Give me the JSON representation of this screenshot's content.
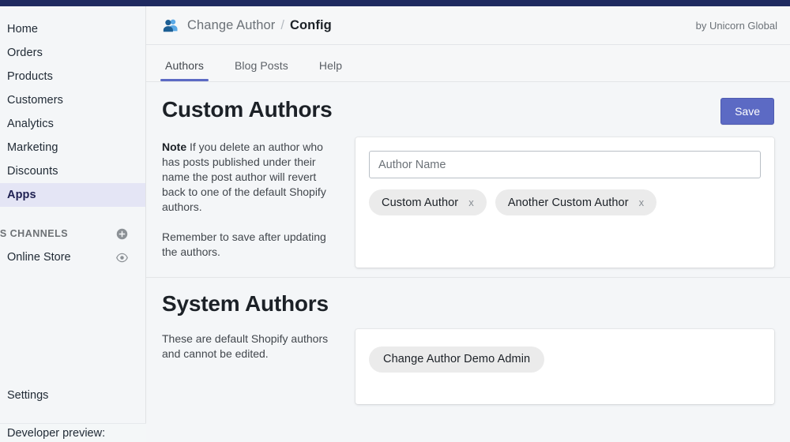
{
  "topbar": {
    "color": "#1f2a60"
  },
  "sidebar": {
    "items": [
      {
        "label": "Home",
        "active": false
      },
      {
        "label": "Orders",
        "active": false
      },
      {
        "label": "Products",
        "active": false
      },
      {
        "label": "Customers",
        "active": false
      },
      {
        "label": "Analytics",
        "active": false
      },
      {
        "label": "Marketing",
        "active": false
      },
      {
        "label": "Discounts",
        "active": false
      },
      {
        "label": "Apps",
        "active": true
      }
    ],
    "section_label": "ES CHANNELS",
    "section_add_icon": "plus-circle-icon",
    "channels": [
      {
        "label": "Online Store",
        "icon": "eye-icon"
      }
    ],
    "settings_label": "Settings",
    "developer_preview_label": "Developer preview:"
  },
  "header": {
    "app_icon": "two-people-icon",
    "breadcrumb_app": "Change Author",
    "breadcrumb_separator": "/",
    "breadcrumb_current": "Config",
    "byline": "by Unicorn Global"
  },
  "tabs": [
    {
      "label": "Authors",
      "active": true
    },
    {
      "label": "Blog Posts",
      "active": false
    },
    {
      "label": "Help",
      "active": false
    }
  ],
  "custom_authors": {
    "title": "Custom Authors",
    "save_label": "Save",
    "note_label": "Note",
    "note_body": " If you delete an author who has posts published under their name the post author will revert back to one of the default Shopify authors.",
    "note_secondary": "Remember to save after updating the authors.",
    "input_placeholder": "Author Name",
    "input_value": "",
    "tags": [
      {
        "label": "Custom Author",
        "remove": "x"
      },
      {
        "label": "Another Custom Author",
        "remove": "x"
      }
    ]
  },
  "system_authors": {
    "title": "System Authors",
    "note": "These are default Shopify authors and cannot be edited.",
    "tags": [
      {
        "label": "Change Author Demo Admin"
      }
    ]
  },
  "colors": {
    "accent_indigo": "#5c6ac4",
    "topbar_navy": "#1f2a60",
    "page_bg": "#f4f6f8",
    "card_bg": "#ffffff",
    "tag_bg": "#ebebeb"
  }
}
